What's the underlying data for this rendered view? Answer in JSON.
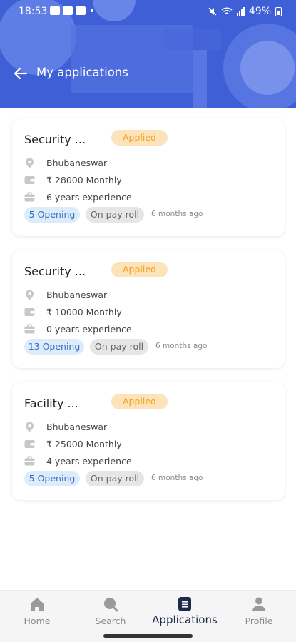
{
  "status_bar": {
    "time": "18:53",
    "battery": "49%"
  },
  "header": {
    "title": "My applications"
  },
  "applications": [
    {
      "title": "Security ...",
      "status": "Applied",
      "location": "Bhubaneswar",
      "salary": "₹ 28000 Monthly",
      "experience": "6 years experience",
      "openings": "5 Opening",
      "pay_type": "On pay roll",
      "posted": "6 months ago"
    },
    {
      "title": "Security ...",
      "status": "Applied",
      "location": "Bhubaneswar",
      "salary": "₹ 10000 Monthly",
      "experience": "0 years experience",
      "openings": "13 Opening",
      "pay_type": "On pay roll",
      "posted": "6 months ago"
    },
    {
      "title": "Facility ...",
      "status": "Applied",
      "location": "Bhubaneswar",
      "salary": "₹ 25000 Monthly",
      "experience": "4 years experience",
      "openings": "5 Opening",
      "pay_type": "On pay roll",
      "posted": "6 months ago"
    }
  ],
  "bottom_nav": {
    "items": [
      {
        "label": "Home",
        "icon": "home-icon"
      },
      {
        "label": "Search",
        "icon": "search-icon"
      },
      {
        "label": "Applications",
        "icon": "applications-icon",
        "active": true
      },
      {
        "label": "Profile",
        "icon": "profile-icon"
      }
    ]
  },
  "colors": {
    "header": "#3f5fd6",
    "applied_bg": "#fde3b9",
    "applied_text": "#f0a020",
    "opening_bg": "#dcecfb",
    "opening_text": "#3a6fc0"
  }
}
